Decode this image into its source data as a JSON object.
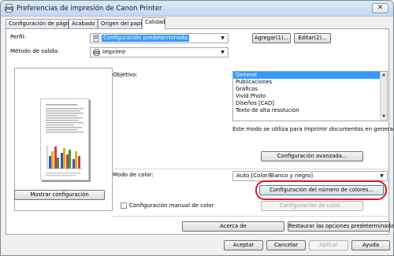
{
  "window": {
    "title": "Preferencias de impresión de Canon Printer",
    "close_glyph": "✕"
  },
  "tabs": [
    {
      "label": "Configuración de página"
    },
    {
      "label": "Acabado"
    },
    {
      "label": "Origen del papel"
    },
    {
      "label": "Calidad"
    }
  ],
  "profile": {
    "label": "Perfil:",
    "value": "Configuración predeterminada",
    "add_label": "Agregar(1)...",
    "edit_label": "Editar(2)..."
  },
  "output": {
    "label": "Método de salida:",
    "value": "Imprimir"
  },
  "objective": {
    "label": "Objetivo:",
    "items": [
      "General",
      "Publicaciones",
      "Gráficos",
      "Vivid Photo",
      "Diseños [CAD]",
      "Texto de alta resolución"
    ],
    "selected_index": 0,
    "description": "Este modo se utiliza para imprimir documentos en general.",
    "advanced_button": "Configuración avanzada..."
  },
  "color": {
    "label": "Modo de color:",
    "value": "Auto [Color/Blanco y negro]",
    "num_colors_button": "Configuración del número de colores...",
    "manual_label": "Configuración manual de color",
    "manual_checked": false,
    "color_settings_button": "Configuración de color..."
  },
  "left": {
    "show_settings_button": "Mostrar configuración"
  },
  "bottom": {
    "about_button": "Acerca de",
    "restore_button": "Restaurar las opciones predeterminadas"
  },
  "dialog": {
    "ok": "Aceptar",
    "cancel": "Cancelar",
    "apply": "Aplicar",
    "help": "Ayuda"
  },
  "colors": {
    "highlight": "#3399ff",
    "annotation_ring": "#e0141e"
  },
  "icons": {
    "printer": "printer-icon",
    "profile": "profile-page-icon",
    "dropdown": "chevron-down-icon"
  }
}
